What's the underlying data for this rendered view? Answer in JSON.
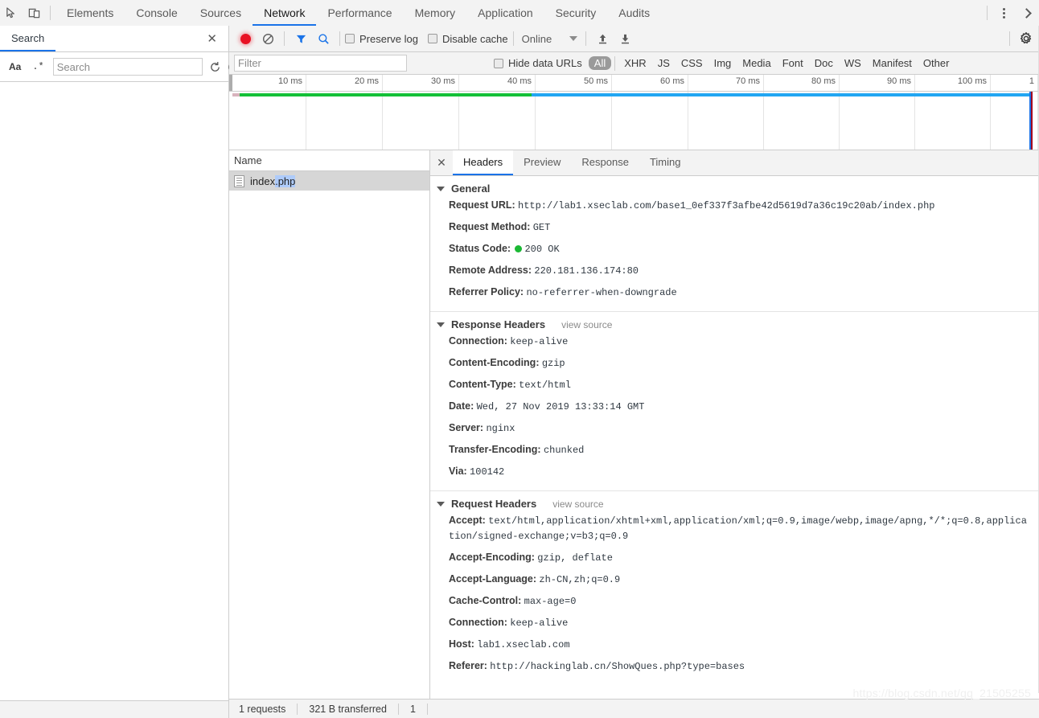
{
  "devtools": {
    "panel_tabs": [
      {
        "label": "Elements",
        "active": false
      },
      {
        "label": "Console",
        "active": false
      },
      {
        "label": "Sources",
        "active": false
      },
      {
        "label": "Network",
        "active": true
      },
      {
        "label": "Performance",
        "active": false
      },
      {
        "label": "Memory",
        "active": false
      },
      {
        "label": "Application",
        "active": false
      },
      {
        "label": "Security",
        "active": false
      },
      {
        "label": "Audits",
        "active": false
      }
    ],
    "inspect_icon": "inspect-element-icon",
    "device_icon": "toggle-device-toolbar-icon",
    "more_icon": "more-options-kebab-icon",
    "close_icon": "close-devtools-icon",
    "accent_color": "#1a73e8"
  },
  "search_panel": {
    "tab_label": "Search",
    "close_label": "✕",
    "match_case_label": "Aa",
    "regex_label": ".*",
    "input_value": "",
    "input_placeholder": "Search",
    "refresh_icon": "refresh-icon",
    "clear_icon": "clear-icon"
  },
  "network_toolbar": {
    "record_icon": "record-button-icon",
    "clear_icon": "clear-network-log-icon",
    "filter_icon": "filter-funnel-icon",
    "search_icon": "search-icon",
    "preserve_log_label": "Preserve log",
    "preserve_log_checked": false,
    "disable_cache_label": "Disable cache",
    "disable_cache_checked": false,
    "throttle_value": "Online",
    "import_icon": "import-har-icon",
    "export_icon": "export-har-icon",
    "settings_icon": "gear-icon",
    "record_color": "#e81123"
  },
  "filter_bar": {
    "filter_value": "",
    "filter_placeholder": "Filter",
    "hide_data_urls_label": "Hide data URLs",
    "hide_data_urls_checked": false,
    "types": [
      {
        "label": "All",
        "active": true
      },
      {
        "label": "XHR",
        "active": false
      },
      {
        "label": "JS",
        "active": false
      },
      {
        "label": "CSS",
        "active": false
      },
      {
        "label": "Img",
        "active": false
      },
      {
        "label": "Media",
        "active": false
      },
      {
        "label": "Font",
        "active": false
      },
      {
        "label": "Doc",
        "active": false
      },
      {
        "label": "WS",
        "active": false
      },
      {
        "label": "Manifest",
        "active": false
      },
      {
        "label": "Other",
        "active": false
      }
    ]
  },
  "overview": {
    "ticks": [
      "10 ms",
      "20 ms",
      "30 ms",
      "40 ms",
      "50 ms",
      "60 ms",
      "70 ms",
      "80 ms",
      "90 ms",
      "100 ms",
      "1"
    ],
    "bar_colors": {
      "stalled": "#d8b3bd",
      "waiting": "#14c038",
      "download": "#22a6f2"
    },
    "marker_blue_color": "#1a73e8",
    "marker_red_color": "#a00020"
  },
  "request_list": {
    "column_header": "Name",
    "rows": [
      {
        "name_prefix": "index",
        "name_selected": ".php",
        "icon": "document-icon",
        "selected": true
      }
    ]
  },
  "details": {
    "close_label": "✕",
    "tabs": [
      {
        "label": "Headers",
        "active": true
      },
      {
        "label": "Preview",
        "active": false
      },
      {
        "label": "Response",
        "active": false
      },
      {
        "label": "Timing",
        "active": false
      }
    ],
    "sections": [
      {
        "title": "General",
        "view_source": null,
        "rows": [
          {
            "name": "Request URL:",
            "value": "http://lab1.xseclab.com/base1_0ef337f3afbe42d5619d7a36c19c20ab/index.php"
          },
          {
            "name": "Request Method:",
            "value": "GET"
          },
          {
            "name": "Status Code:",
            "value": "200 OK",
            "status_dot": true
          },
          {
            "name": "Remote Address:",
            "value": "220.181.136.174:80"
          },
          {
            "name": "Referrer Policy:",
            "value": "no-referrer-when-downgrade"
          }
        ]
      },
      {
        "title": "Response Headers",
        "view_source": "view source",
        "rows": [
          {
            "name": "Connection:",
            "value": "keep-alive"
          },
          {
            "name": "Content-Encoding:",
            "value": "gzip"
          },
          {
            "name": "Content-Type:",
            "value": "text/html"
          },
          {
            "name": "Date:",
            "value": "Wed, 27 Nov 2019 13:33:14 GMT"
          },
          {
            "name": "Server:",
            "value": "nginx"
          },
          {
            "name": "Transfer-Encoding:",
            "value": "chunked"
          },
          {
            "name": "Via:",
            "value": "100142"
          }
        ]
      },
      {
        "title": "Request Headers",
        "view_source": "view source",
        "rows": [
          {
            "name": "Accept:",
            "value": "text/html,application/xhtml+xml,application/xml;q=0.9,image/webp,image/apng,*/*;q=0.8,application/signed-exchange;v=b3;q=0.9"
          },
          {
            "name": "Accept-Encoding:",
            "value": "gzip, deflate"
          },
          {
            "name": "Accept-Language:",
            "value": "zh-CN,zh;q=0.9"
          },
          {
            "name": "Cache-Control:",
            "value": "max-age=0"
          },
          {
            "name": "Connection:",
            "value": "keep-alive"
          },
          {
            "name": "Host:",
            "value": "lab1.xseclab.com"
          },
          {
            "name": "Referer:",
            "value": "http://hackinglab.cn/ShowQues.php?type=bases"
          }
        ]
      }
    ]
  },
  "status_bar": {
    "requests": "1 requests",
    "transferred": "321 B transferred",
    "resources": "1"
  },
  "watermark": "https://blog.csdn.net/qq_21505255"
}
